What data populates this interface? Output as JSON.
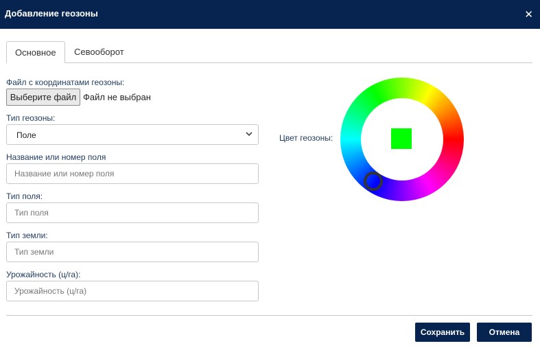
{
  "dialog": {
    "title": "Добавление геозоны",
    "close_icon": "close-icon"
  },
  "tabs": [
    {
      "label": "Основное",
      "active": true
    },
    {
      "label": "Севооборот",
      "active": false
    }
  ],
  "form": {
    "file": {
      "label": "Файл с координатами геозоны:",
      "button_label": "Выберите файл",
      "status": "Файл не выбран"
    },
    "geozone_type": {
      "label": "Тип геозоны:",
      "value": "Поле"
    },
    "field_name": {
      "label": "Название или номер поля",
      "placeholder": "Название или номер поля",
      "value": ""
    },
    "field_type": {
      "label": "Тип поля:",
      "placeholder": "Тип поля",
      "value": ""
    },
    "land_type": {
      "label": "Тип земли:",
      "placeholder": "Тип земли",
      "value": ""
    },
    "yield": {
      "label": "Урожайность (ц/га):",
      "placeholder": "Урожайность (ц/га)",
      "value": ""
    }
  },
  "color_picker": {
    "label": "Цвет геозоны:",
    "selected_color": "#00ff00"
  },
  "footer": {
    "save_label": "Сохранить",
    "cancel_label": "Отмена"
  },
  "colors": {
    "header_bg": "#06244f",
    "button_bg": "#06244f",
    "label_text": "#1e3a5f"
  }
}
